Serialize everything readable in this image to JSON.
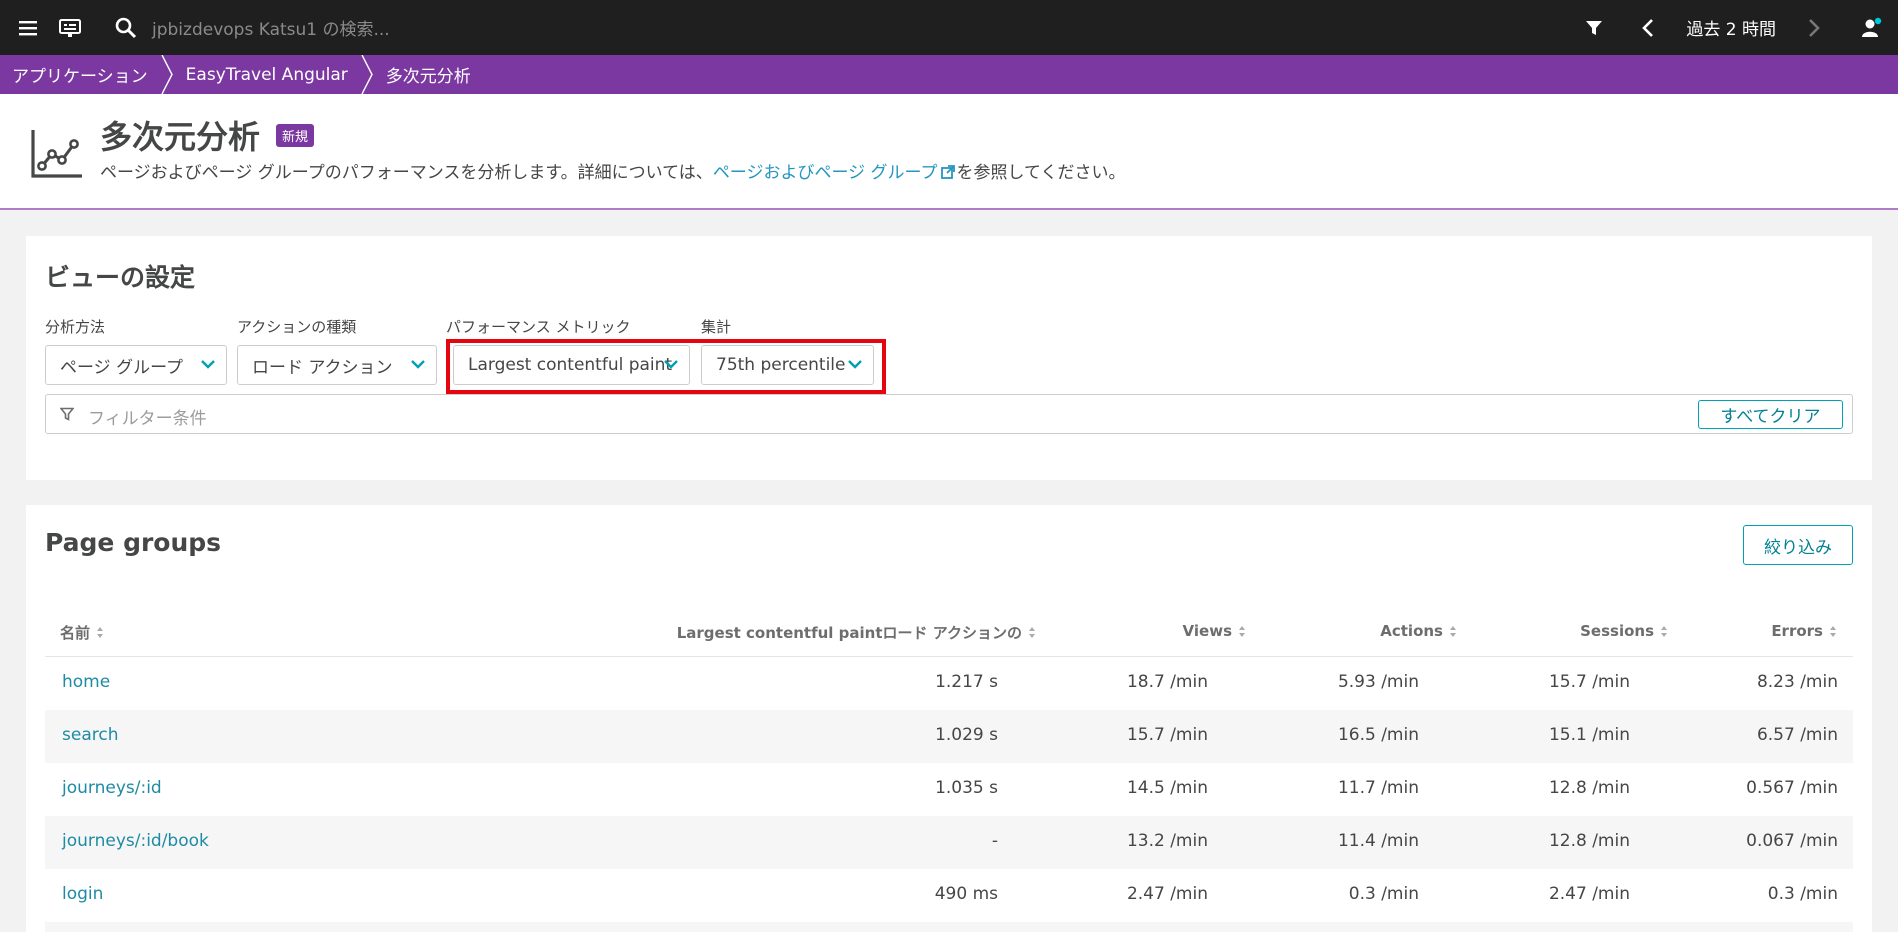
{
  "topbar": {
    "search_placeholder": "jpbizdevops Katsu1 の検索...",
    "timeframe": "過去 2 時間"
  },
  "breadcrumb": [
    "アプリケーション",
    "EasyTravel Angular",
    "多次元分析"
  ],
  "header": {
    "title": "多次元分析",
    "badge": "新規",
    "desc_before": "ページおよびページ グループのパフォーマンスを分析します。詳細については、",
    "desc_link": "ページおよびページ グループ",
    "desc_after": "を参照してください。"
  },
  "settings": {
    "title": "ビューの設定",
    "fields": [
      {
        "label": "分析方法",
        "value": "ページ グループ"
      },
      {
        "label": "アクションの種類",
        "value": "ロード アクション"
      },
      {
        "label": "パフォーマンス メトリック",
        "value": "Largest contentful paint"
      },
      {
        "label": "集計",
        "value": "75th percentile"
      }
    ],
    "filter_placeholder": "フィルター条件",
    "clear_all": "すべてクリア"
  },
  "page_groups": {
    "title": "Page groups",
    "filter_button": "絞り込み",
    "columns": [
      "名前",
      "Largest contentful paintロード アクションの",
      "Views",
      "Actions",
      "Sessions",
      "Errors"
    ],
    "rows": [
      [
        "home",
        "1.217 s",
        "18.7 /min",
        "5.93 /min",
        "15.7 /min",
        "8.23 /min"
      ],
      [
        "search",
        "1.029 s",
        "15.7 /min",
        "16.5 /min",
        "15.1 /min",
        "6.57 /min"
      ],
      [
        "journeys/:id",
        "1.035 s",
        "14.5 /min",
        "11.7 /min",
        "12.8 /min",
        "0.567 /min"
      ],
      [
        "journeys/:id/book",
        "-",
        "13.2 /min",
        "11.4 /min",
        "12.8 /min",
        "0.067 /min"
      ],
      [
        "login",
        "490 ms",
        "2.47 /min",
        "0.3 /min",
        "2.47 /min",
        "0.3 /min"
      ]
    ]
  },
  "colors": {
    "topbar": "#1f1f1f",
    "breadcrumb": "#7c38a1",
    "link": "#1e8ba4",
    "highlight": "#e4050f",
    "accent": "#00a1b2"
  }
}
